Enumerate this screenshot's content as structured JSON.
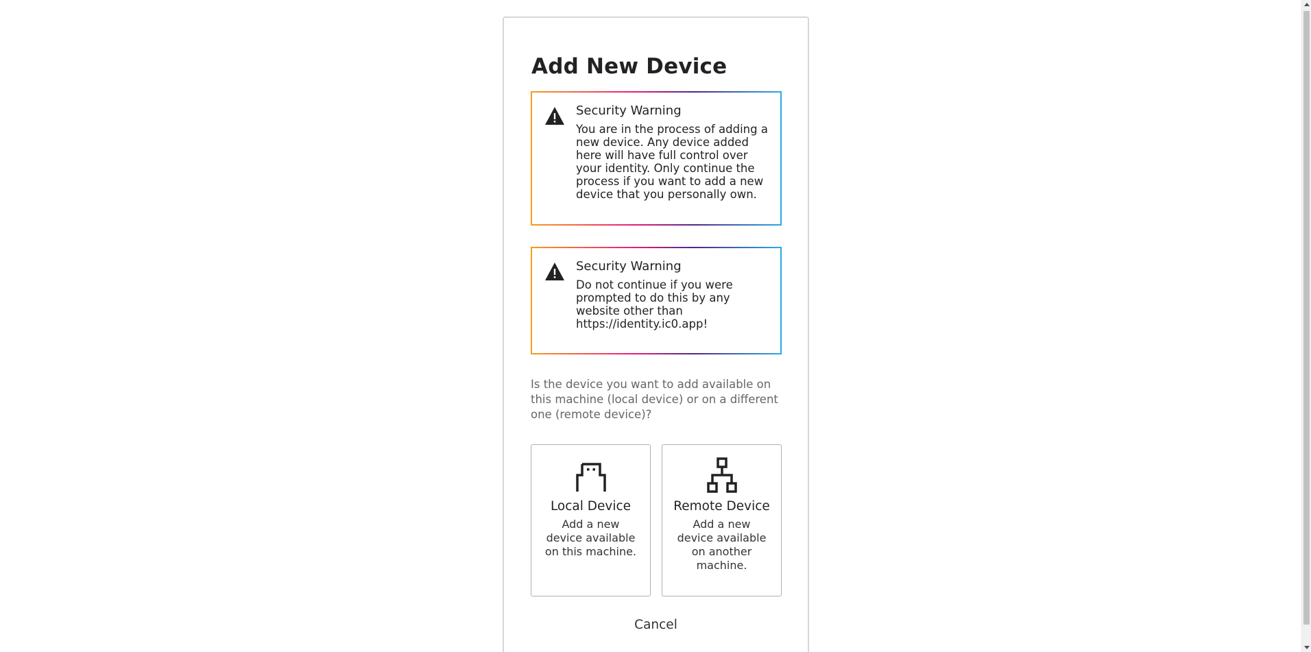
{
  "page": {
    "title": "Add New Device"
  },
  "warnings": [
    {
      "icon": "warning-icon",
      "title": "Security Warning",
      "text": "You are in the process of adding a new device. Any device added here will have full control over your identity. Only continue the process if you want to add a new device that you personally own."
    },
    {
      "icon": "warning-icon",
      "title": "Security Warning",
      "text": "Do not continue if you were prompted to do this by any website other than https://identity.ic0.app!"
    }
  ],
  "question": "Is the device you want to add available on this machine (local device) or on a different one (remote device)?",
  "options": {
    "local": {
      "icon": "usb-key-icon",
      "title": "Local Device",
      "description": "Add a new device available on this machine."
    },
    "remote": {
      "icon": "network-icon",
      "title": "Remote Device",
      "description": "Add a new device available on another machine."
    }
  },
  "cancel_label": "Cancel",
  "colors": {
    "gradient": [
      "#f59f1d",
      "#ed1e79",
      "#522785",
      "#29abe2"
    ],
    "text": "#222222",
    "muted": "#666666"
  }
}
